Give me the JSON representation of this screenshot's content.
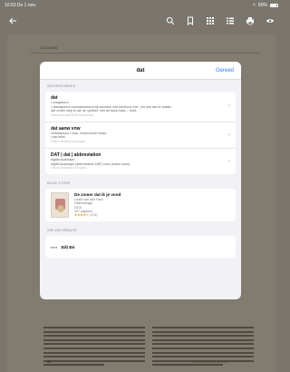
{
  "status": {
    "time": "10:53",
    "date": "Do 1 nov.",
    "battery": "60%"
  },
  "reader": {
    "chapter_header": "COLUMN",
    "page_number": "41",
    "footer_text": "DE ZOMER DAT IK JE VOND"
  },
  "modal": {
    "title": "dat",
    "done_label": "Gereed",
    "dictionary": {
      "section_label": "WOORDENBOEK",
      "entries": [
        {
          "term": "dat",
          "lines": [
            "I voegwoord",
            "1 aanwijzend voornaamwoord bij woorden met klemtoon 'het', om iets aan te duiden",
            "dat verder weg is van de spreker: niet dit boek maar – boek"
          ],
          "source": "Prisma woordenboek Nederlands"
        },
        {
          "term": "dat aanw vnw",
          "lines": [
            "verbalwoord » that, »meervoud« those",
            "• dat alles"
          ],
          "source": "Prisma Nederlands-Engels"
        },
        {
          "term": "DAT | dat | abbreviation",
          "lines": [
            "digital audiotape.",
            "digital audiotape (abbreviation DAT) noun [mass noun]"
          ],
          "source": "Oxford Dictionary of English"
        }
      ]
    },
    "bookstore": {
      "section_label": "BOOK STORE",
      "book": {
        "title": "De zomer dat ik je vond",
        "author": "Lizzie van den Ham",
        "publisher": "Heilenstrage",
        "year": "2015",
        "pages": "157 pagina's",
        "stars": "★★★★☆",
        "rating_count": "(475)"
      }
    },
    "siri": {
      "section_label": "SIRI-INFORMATIE",
      "mark": "▪▪▪▪",
      "title": "Đất Đỏ"
    }
  }
}
